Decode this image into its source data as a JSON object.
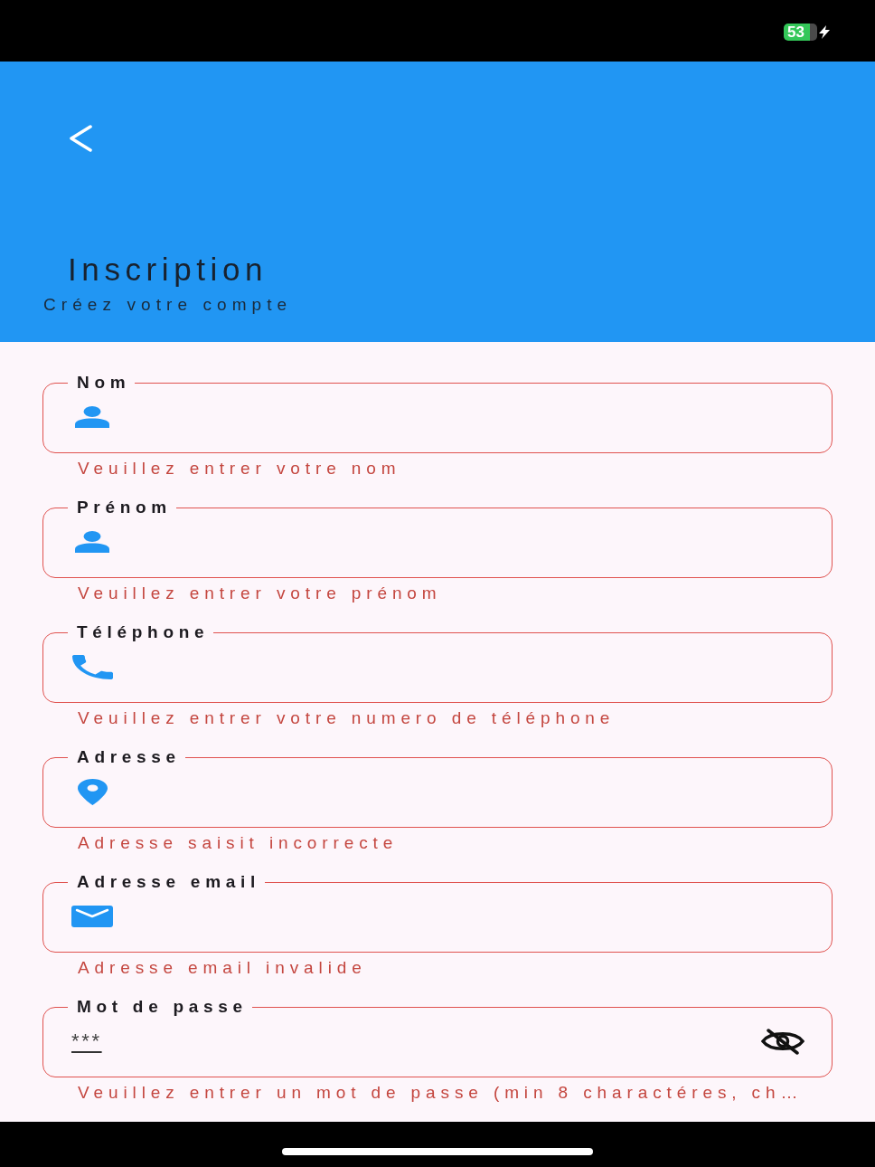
{
  "status_bar": {
    "battery": "53",
    "charging": true
  },
  "header": {
    "title": "Inscription",
    "subtitle": "Créez votre compte"
  },
  "fields": [
    {
      "kind": "person",
      "label": "Nom",
      "error": "Veuillez entrer votre nom"
    },
    {
      "kind": "person",
      "label": "Prénom",
      "error": "Veuillez entrer votre prénom"
    },
    {
      "kind": "phone",
      "label": "Téléphone",
      "error": "Veuillez entrer votre numero de téléphone"
    },
    {
      "kind": "address",
      "label": "Adresse",
      "error": "Adresse saisit incorrecte"
    },
    {
      "kind": "email",
      "label": "Adresse email",
      "error": "Adresse email invalide"
    },
    {
      "kind": "password",
      "label": "Mot de passe",
      "value": "***",
      "obscured": true,
      "error": "Veuillez entrer un mot de passe (min 8 charactéres, ch…"
    }
  ]
}
